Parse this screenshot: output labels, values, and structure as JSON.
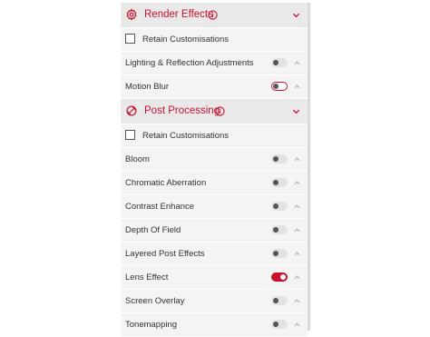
{
  "colors": {
    "accent": "#c8102e",
    "header_bg": "#e9e9e9",
    "row_bg": "#f4f4f4"
  },
  "sections": [
    {
      "title": "Render Effects",
      "icon": "gear-icon",
      "retain_label": "Retain Customisations",
      "retain_checked": false,
      "settings": [
        {
          "label": "Lighting & Reflection Adjustments",
          "enabled": false
        },
        {
          "label": "Motion Blur",
          "enabled": false
        }
      ]
    },
    {
      "title": "Post Processing",
      "icon": "post-processing-icon",
      "retain_label": "Retain Customisations",
      "retain_checked": false,
      "settings": [
        {
          "label": "Bloom",
          "enabled": false
        },
        {
          "label": "Chromatic Aberration",
          "enabled": false
        },
        {
          "label": "Contrast Enhance",
          "enabled": false
        },
        {
          "label": "Depth Of Field",
          "enabled": false
        },
        {
          "label": "Layered Post Effects",
          "enabled": false
        },
        {
          "label": "Lens Effect",
          "enabled": true
        },
        {
          "label": "Screen Overlay",
          "enabled": false
        },
        {
          "label": "Tonemapping",
          "enabled": false
        }
      ]
    }
  ]
}
